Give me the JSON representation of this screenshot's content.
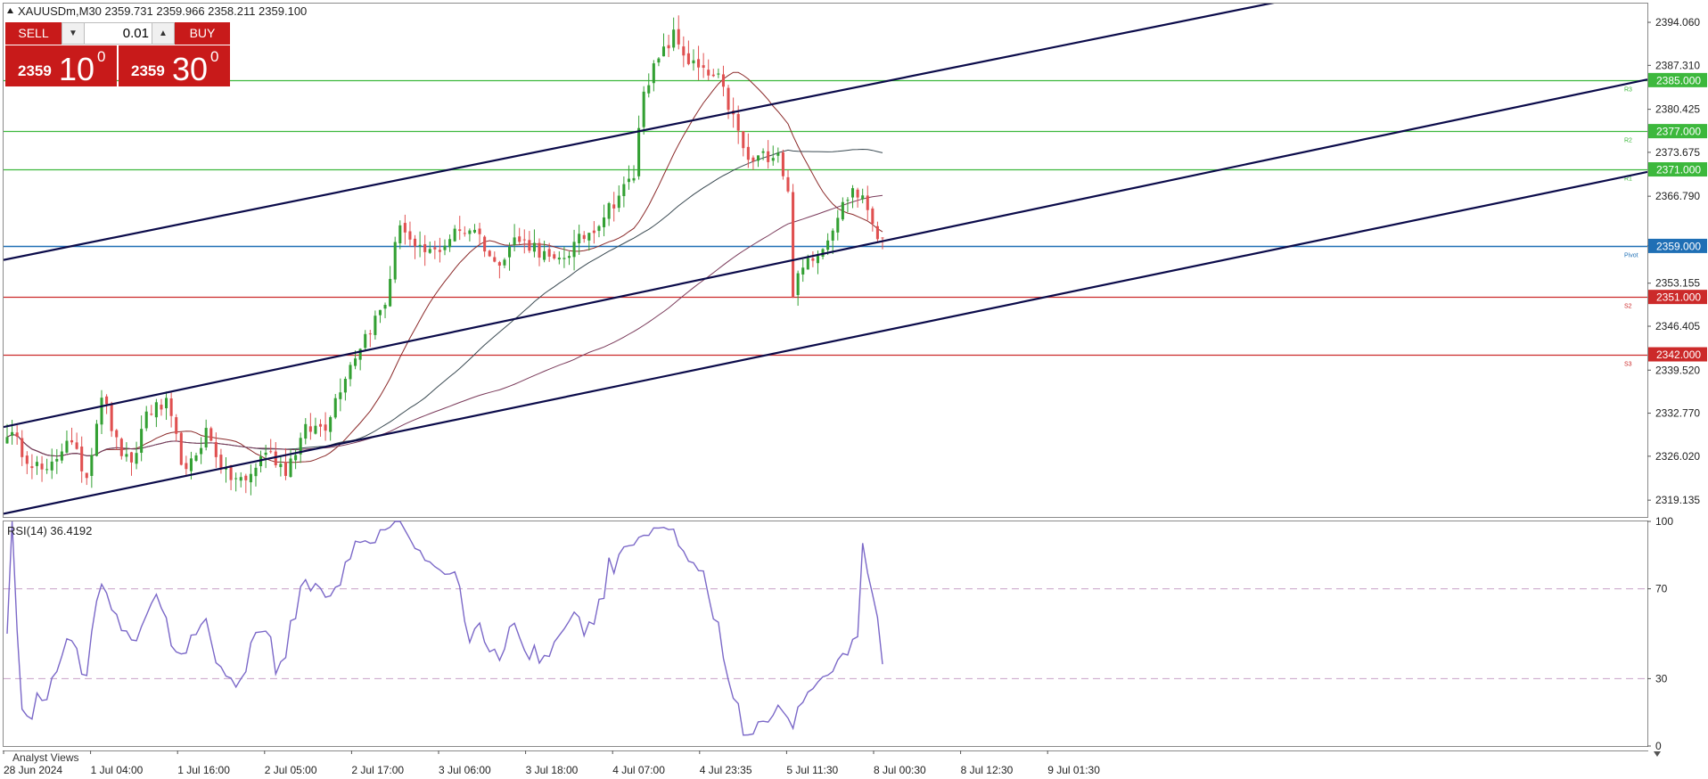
{
  "header": {
    "symbol_line": "XAUUSDm,M30  2359.731 2359.966 2358.211 2359.100",
    "rsi_label": "RSI(14) 36.4192",
    "bottom_tab": "Analyst Views"
  },
  "trade_panel": {
    "sell_label": "SELL",
    "buy_label": "BUY",
    "lot_value": "0.01",
    "step_down": "▼",
    "step_up": "▲",
    "sell_price_small": "2359",
    "sell_price_big": "10",
    "sell_price_sup": "0",
    "buy_price_small": "2359",
    "buy_price_big": "30",
    "buy_price_sup": "0"
  },
  "colors": {
    "bull": "#33a033",
    "bear": "#e05050",
    "channel": "#0b0b4a",
    "resistance": "#3cb83c",
    "support": "#cc2a2a",
    "pivot": "#1f6fb5",
    "rsi": "#7b68c8"
  },
  "chart_data": {
    "type": "candlestick",
    "symbol": "XAUUSDm",
    "timeframe": "M30",
    "ylim": [
      2316.5,
      2397.0
    ],
    "price_ticks": [
      "2394.060",
      "2387.310",
      "2380.425",
      "2373.675",
      "2366.790",
      "2359.040",
      "2353.155",
      "2346.405",
      "2339.520",
      "2332.770",
      "2326.020",
      "2319.135"
    ],
    "time_ticks": [
      "28 Jun 2024",
      "1 Jul 04:00",
      "1 Jul 16:00",
      "2 Jul 05:00",
      "2 Jul 17:00",
      "3 Jul 06:00",
      "3 Jul 18:00",
      "4 Jul 07:00",
      "4 Jul 23:35",
      "5 Jul 11:30",
      "8 Jul 00:30",
      "8 Jul 12:30",
      "9 Jul 01:30"
    ],
    "levels": [
      {
        "name": "R3",
        "price": 2385.0,
        "label": "2385.000",
        "kind": "resistance"
      },
      {
        "name": "R2",
        "price": 2377.0,
        "label": "2377.000",
        "kind": "resistance"
      },
      {
        "name": "R1",
        "price": 2371.0,
        "label": "2371.000",
        "kind": "resistance"
      },
      {
        "name": "Pivot",
        "price": 2359.0,
        "label": "2359.000",
        "kind": "pivot"
      },
      {
        "name": "S2",
        "price": 2351.0,
        "label": "2351.000",
        "kind": "support"
      },
      {
        "name": "S3",
        "price": 2342.0,
        "label": "2342.000",
        "kind": "support"
      }
    ],
    "channel_lines": [
      {
        "x1": 0.0,
        "y1": 2356.8,
        "x2": 1.0,
        "y2": 2409.0
      },
      {
        "x1": 0.0,
        "y1": 2330.6,
        "x2": 1.0,
        "y2": 2385.1
      },
      {
        "x1": 0.0,
        "y1": 2317.0,
        "x2": 1.0,
        "y2": 2370.6
      }
    ],
    "anchors": [
      {
        "i": 0,
        "p": 2330
      },
      {
        "i": 4,
        "p": 2326
      },
      {
        "i": 8,
        "p": 2323
      },
      {
        "i": 12,
        "p": 2329
      },
      {
        "i": 16,
        "p": 2323
      },
      {
        "i": 19,
        "p": 2336
      },
      {
        "i": 22,
        "p": 2328
      },
      {
        "i": 25,
        "p": 2324
      },
      {
        "i": 28,
        "p": 2333
      },
      {
        "i": 32,
        "p": 2334
      },
      {
        "i": 36,
        "p": 2323
      },
      {
        "i": 40,
        "p": 2330
      },
      {
        "i": 44,
        "p": 2323
      },
      {
        "i": 48,
        "p": 2322
      },
      {
        "i": 52,
        "p": 2327
      },
      {
        "i": 56,
        "p": 2324
      },
      {
        "i": 60,
        "p": 2330
      },
      {
        "i": 64,
        "p": 2331
      },
      {
        "i": 68,
        "p": 2339
      },
      {
        "i": 72,
        "p": 2345
      },
      {
        "i": 76,
        "p": 2350
      },
      {
        "i": 79,
        "p": 2363
      },
      {
        "i": 82,
        "p": 2358
      },
      {
        "i": 86,
        "p": 2358
      },
      {
        "i": 90,
        "p": 2361
      },
      {
        "i": 94,
        "p": 2362
      },
      {
        "i": 98,
        "p": 2356
      },
      {
        "i": 102,
        "p": 2360
      },
      {
        "i": 106,
        "p": 2359
      },
      {
        "i": 110,
        "p": 2356
      },
      {
        "i": 114,
        "p": 2359
      },
      {
        "i": 118,
        "p": 2362
      },
      {
        "i": 122,
        "p": 2366
      },
      {
        "i": 126,
        "p": 2370
      },
      {
        "i": 128,
        "p": 2384
      },
      {
        "i": 131,
        "p": 2388
      },
      {
        "i": 134,
        "p": 2392
      },
      {
        "i": 137,
        "p": 2388
      },
      {
        "i": 140,
        "p": 2386
      },
      {
        "i": 143,
        "p": 2385
      },
      {
        "i": 146,
        "p": 2379
      },
      {
        "i": 149,
        "p": 2372
      },
      {
        "i": 152,
        "p": 2373
      },
      {
        "i": 155,
        "p": 2374
      },
      {
        "i": 157,
        "p": 2367
      },
      {
        "i": 158,
        "p": 2352
      },
      {
        "i": 161,
        "p": 2357
      },
      {
        "i": 164,
        "p": 2359
      },
      {
        "i": 167,
        "p": 2364
      },
      {
        "i": 170,
        "p": 2368
      },
      {
        "i": 173,
        "p": 2365
      },
      {
        "i": 176,
        "p": 2359
      }
    ],
    "candle_count": 177,
    "moving_averages": [
      {
        "period": 20,
        "color": "#8b2a2a"
      },
      {
        "period": 50,
        "color": "#3a4a52"
      },
      {
        "period": 100,
        "color": "#7a3a5a"
      }
    ],
    "rsi": {
      "period": 14,
      "value": 36.4192,
      "levels": [
        70,
        30
      ],
      "ticks": [
        "100",
        "70",
        "30",
        "0"
      ],
      "ylim": [
        0,
        100
      ]
    }
  }
}
